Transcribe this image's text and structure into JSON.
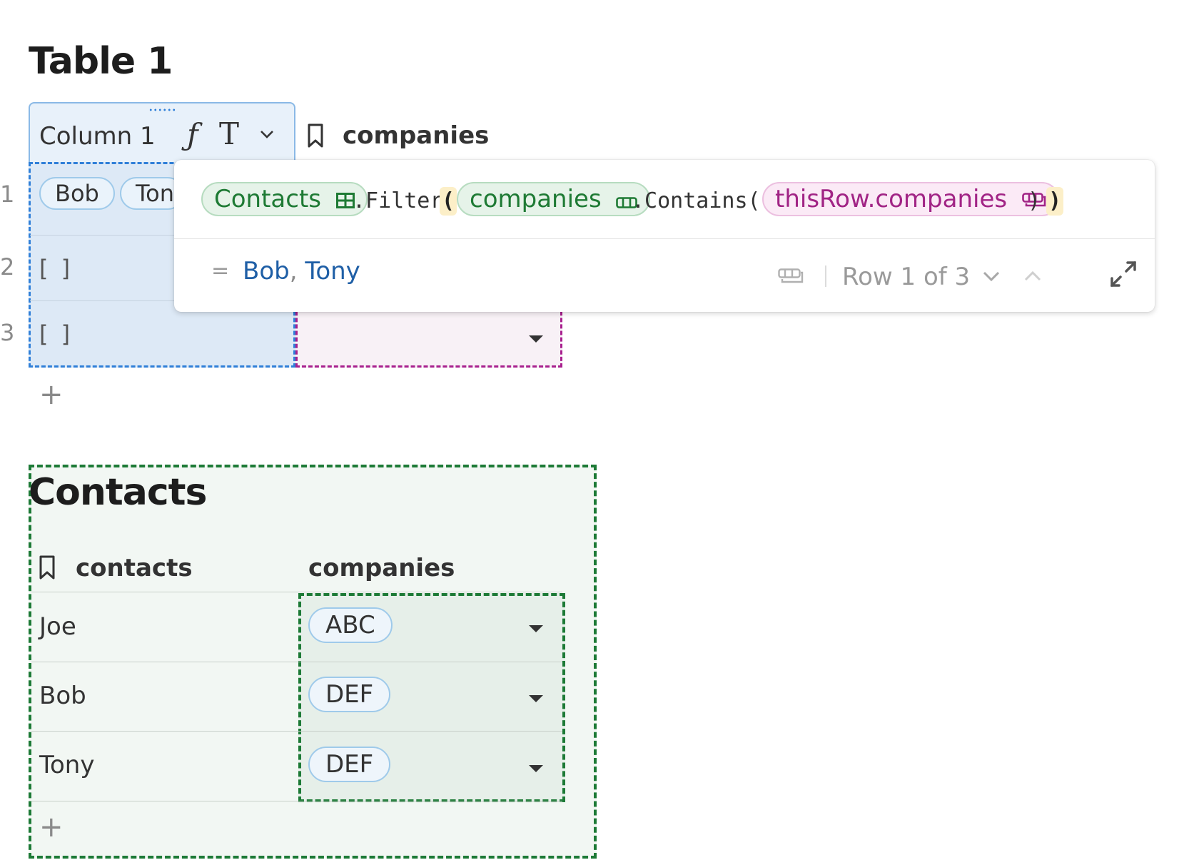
{
  "table1": {
    "title": "Table 1",
    "column1_label": "Column 1",
    "column2_label": "companies",
    "row_numbers": [
      "1",
      "2",
      "3"
    ],
    "row1_chips": [
      "Bob",
      "Ton"
    ],
    "row2_value": "[ ]",
    "row3_value": "[ ]",
    "add_row_label": "+"
  },
  "icons": {
    "formula": "ƒ",
    "text_type": "T",
    "chevron": "⌄",
    "nav_down": "⌄",
    "nav_up": "⌃",
    "equals": "="
  },
  "formula": {
    "token_table": "Contacts",
    "method_filter": ".Filter",
    "paren_open": "(",
    "token_column": "companies",
    "method_contains": ".Contains(",
    "token_thisrow": "thisRow.companies",
    "close_normal": ")",
    "paren_close": ")",
    "result_values": [
      "Bob",
      "Tony"
    ],
    "result_separator": ",",
    "row_indicator": "Row 1 of 3"
  },
  "contacts": {
    "title": "Contacts",
    "headers": [
      "contacts",
      "companies"
    ],
    "rows": [
      {
        "name": "Joe",
        "company": "ABC"
      },
      {
        "name": "Bob",
        "company": "DEF"
      },
      {
        "name": "Tony",
        "company": "DEF"
      }
    ],
    "add_row_label": "+"
  },
  "colors": {
    "selected_column_blue": "#2f7fd8",
    "companies_column_purple": "#a8208e",
    "contacts_table_green": "#1d7a36",
    "result_blue": "#1f5fa6"
  }
}
